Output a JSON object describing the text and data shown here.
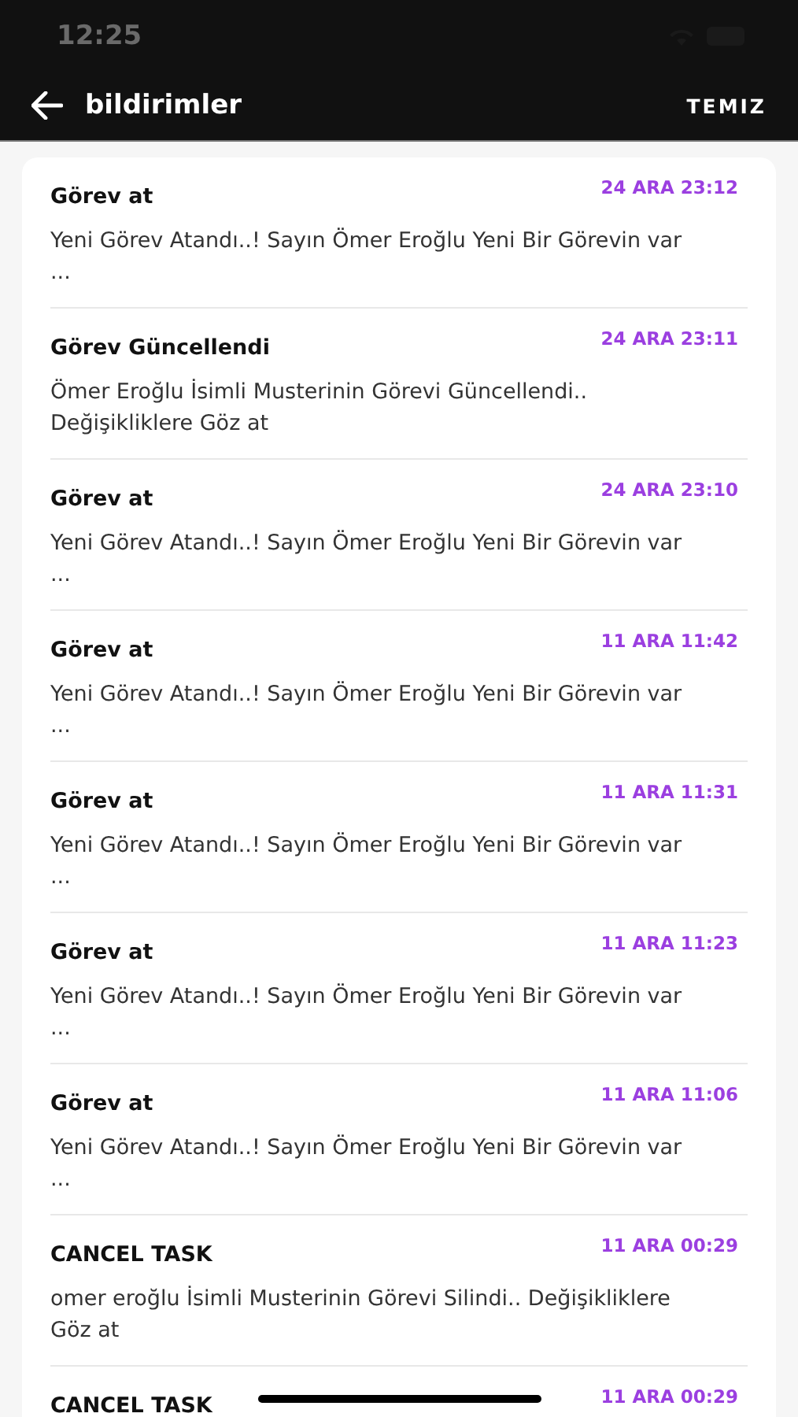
{
  "status_bar": {
    "time": "12:25"
  },
  "app_bar": {
    "title": "bildirimler",
    "action": "TEMIZ"
  },
  "notifications": [
    {
      "title": "Görev at",
      "time": "24 ARA 23:12",
      "body": "Yeni Görev Atandı..! Sayın Ömer Eroğlu Yeni Bir Görevin var ..."
    },
    {
      "title": "Görev Güncellendi",
      "time": "24 ARA 23:11",
      "body": "Ömer Eroğlu İsimli Musterinin Görevi Güncellendi.. Değişikliklere Göz at"
    },
    {
      "title": "Görev at",
      "time": "24 ARA 23:10",
      "body": "Yeni Görev Atandı..! Sayın Ömer Eroğlu Yeni Bir Görevin var ..."
    },
    {
      "title": "Görev at",
      "time": "11 ARA 11:42",
      "body": "Yeni Görev Atandı..! Sayın Ömer Eroğlu Yeni Bir Görevin var ..."
    },
    {
      "title": "Görev at",
      "time": "11 ARA 11:31",
      "body": "Yeni Görev Atandı..! Sayın Ömer Eroğlu Yeni Bir Görevin var ..."
    },
    {
      "title": "Görev at",
      "time": "11 ARA 11:23",
      "body": "Yeni Görev Atandı..! Sayın Ömer Eroğlu Yeni Bir Görevin var ..."
    },
    {
      "title": "Görev at",
      "time": "11 ARA 11:06",
      "body": "Yeni Görev Atandı..! Sayın Ömer Eroğlu Yeni Bir Görevin var ..."
    },
    {
      "title": "CANCEL TASK",
      "time": "11 ARA 00:29",
      "body": "omer eroğlu İsimli Musterinin Görevi Silindi.. Değişikliklere Göz at"
    },
    {
      "title": "CANCEL TASK",
      "time": "11 ARA 00:29"
    }
  ]
}
